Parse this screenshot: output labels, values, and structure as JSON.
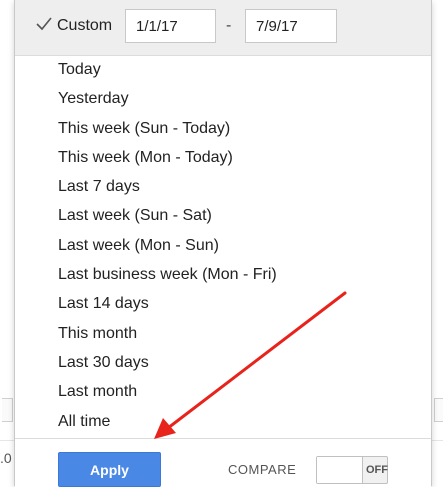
{
  "header": {
    "custom_label": "Custom",
    "start_date": "1/1/17",
    "separator": "-",
    "end_date": "7/9/17"
  },
  "presets": [
    {
      "label": "Today"
    },
    {
      "label": "Yesterday"
    },
    {
      "label": "This week (Sun - Today)"
    },
    {
      "label": "This week (Mon - Today)"
    },
    {
      "label": "Last 7 days"
    },
    {
      "label": "Last week (Sun - Sat)"
    },
    {
      "label": "Last week (Mon - Sun)"
    },
    {
      "label": "Last business week (Mon - Fri)"
    },
    {
      "label": "Last 14 days"
    },
    {
      "label": "This month"
    },
    {
      "label": "Last 30 days"
    },
    {
      "label": "Last month"
    },
    {
      "label": "All time"
    }
  ],
  "footer": {
    "apply_label": "Apply",
    "compare_label": "COMPARE",
    "toggle_label": "OFF"
  },
  "background": {
    "left_fragment": ".0"
  },
  "colors": {
    "apply_button": "#4a88e6",
    "annotation_arrow": "#e8231c"
  },
  "icons": {
    "selected_mark": "checkmark-icon"
  }
}
